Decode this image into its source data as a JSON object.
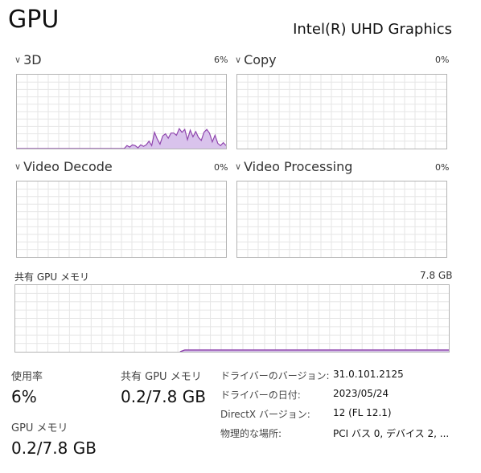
{
  "header": {
    "title": "GPU",
    "device_name": "Intel(R) UHD Graphics"
  },
  "engines": [
    {
      "label": "3D",
      "percent": "6%",
      "icon": "chevron-down-icon",
      "samples": [
        0,
        0,
        0,
        0,
        0,
        0,
        0,
        0,
        0,
        0,
        0,
        0,
        0,
        0,
        0,
        0,
        0,
        0,
        0,
        0,
        0,
        0,
        0,
        0,
        0,
        0,
        0,
        0,
        0,
        0,
        0,
        0,
        0,
        0,
        0,
        0,
        0,
        0,
        0,
        0,
        0.04,
        0.02,
        0.05,
        0.04,
        0.01,
        0.05,
        0.03,
        0.05,
        0.1,
        0.04,
        0.22,
        0.13,
        0.06,
        0.17,
        0.2,
        0.14,
        0.21,
        0.21,
        0.18,
        0.27,
        0.22,
        0.26,
        0.12,
        0.25,
        0.16,
        0.23,
        0.15,
        0.11,
        0.22,
        0.26,
        0.21,
        0.09,
        0.18,
        0.07,
        0.04,
        0.08,
        0.04
      ]
    },
    {
      "label": "Copy",
      "percent": "0%",
      "icon": "chevron-down-icon",
      "samples": []
    },
    {
      "label": "Video Decode",
      "percent": "0%",
      "icon": "chevron-down-icon",
      "samples": []
    },
    {
      "label": "Video Processing",
      "percent": "0%",
      "icon": "chevron-down-icon",
      "samples": []
    }
  ],
  "shared_memory_graph": {
    "label": "共有 GPU メモリ",
    "max": "7.8 GB",
    "level_fraction_start": 0.0,
    "level_fraction": 0.026
  },
  "stats": {
    "utilization_label": "使用率",
    "utilization_value": "6%",
    "shared_label": "共有 GPU メモリ",
    "shared_value": "0.2/7.8 GB",
    "gpu_mem_label": "GPU メモリ",
    "gpu_mem_value": "0.2/7.8 GB"
  },
  "details": [
    {
      "label": "ドライバーのバージョン:",
      "value": "31.0.101.2125"
    },
    {
      "label": "ドライバーの日付:",
      "value": "2023/05/24"
    },
    {
      "label": "DirectX バージョン:",
      "value": "12 (FL 12.1)"
    },
    {
      "label": "物理的な場所:",
      "value": "PCI バス 0, デバイス 2, ..."
    }
  ],
  "colors": {
    "graph_line": "#8e44ad",
    "graph_fill": "#d9c3ec",
    "grid": "#e6e6e6",
    "border": "#b4b4b4"
  }
}
